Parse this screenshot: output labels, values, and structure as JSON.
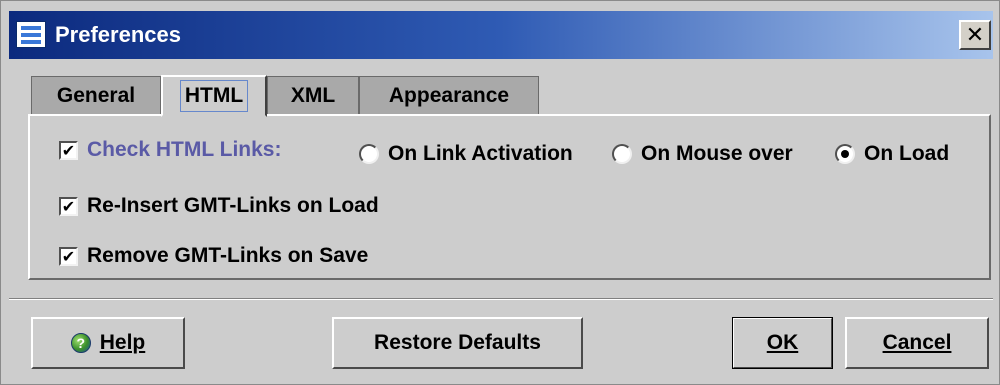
{
  "window": {
    "title": "Preferences",
    "close_glyph": "✕"
  },
  "tabs": [
    {
      "label": "General",
      "active": false
    },
    {
      "label": "HTML",
      "active": true
    },
    {
      "label": "XML",
      "active": false
    },
    {
      "label": "Appearance",
      "active": false
    }
  ],
  "options": {
    "check_html_links": {
      "label": "Check HTML Links:",
      "checked": true,
      "mark": "✔",
      "color": "#5a5aa6"
    },
    "radios": [
      {
        "label": "On Link Activation",
        "selected": false
      },
      {
        "label": "On Mouse over",
        "selected": false
      },
      {
        "label": "On Load",
        "selected": true
      }
    ],
    "reinsert": {
      "label": "Re-Insert GMT-Links on Load",
      "checked": true,
      "mark": "✔"
    },
    "remove": {
      "label": "Remove GMT-Links on Save",
      "checked": true,
      "mark": "✔"
    }
  },
  "buttons": {
    "help": "Help",
    "help_icon": "help-globe-icon",
    "restore": "Restore Defaults",
    "ok": "OK",
    "cancel": "Cancel"
  },
  "colors": {
    "title_bar_start": "#0c2a7e",
    "title_bar_end": "#a8c4ec",
    "dialog_bg": "#cdcdcd"
  }
}
